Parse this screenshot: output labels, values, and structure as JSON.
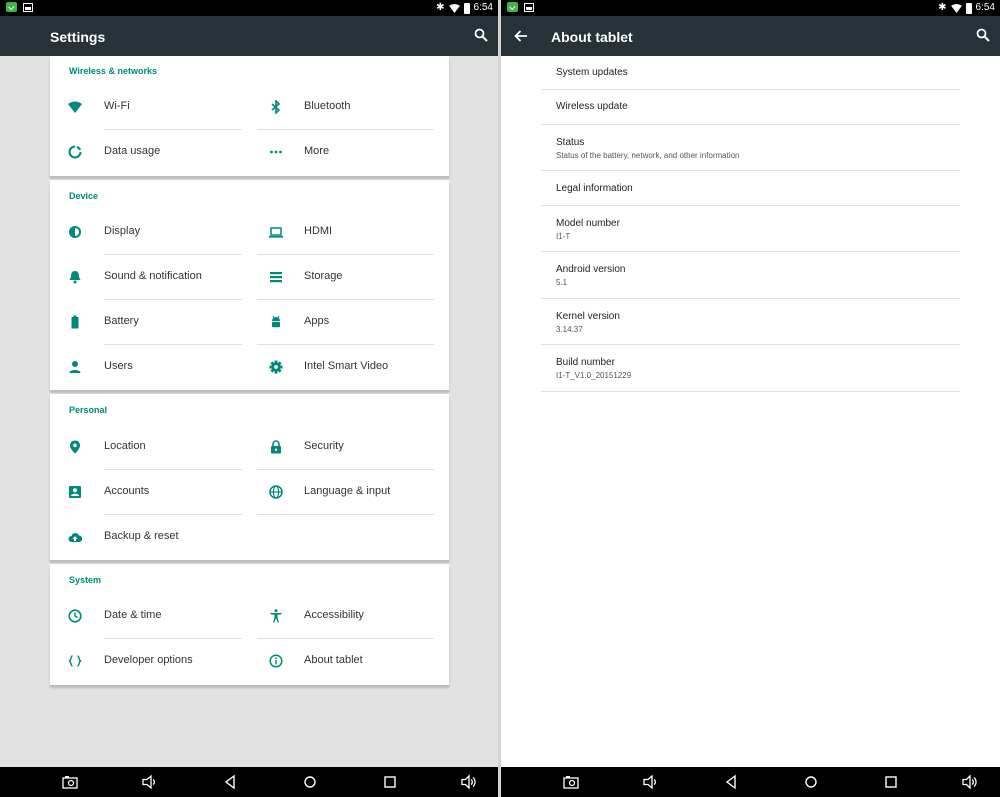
{
  "status_bar": {
    "time": "6:54",
    "icons": [
      "notification-icon",
      "image-icon",
      "bluetooth-icon",
      "wifi-icon",
      "battery-icon"
    ]
  },
  "settings": {
    "title": "Settings",
    "sections": [
      {
        "label": "Wireless & networks",
        "items": [
          "Wi-Fi",
          "Bluetooth",
          "Data usage",
          "More"
        ]
      },
      {
        "label": "Device",
        "items": [
          "Display",
          "HDMI",
          "Sound & notification",
          "Storage",
          "Battery",
          "Apps",
          "Users",
          "Intel Smart Video"
        ]
      },
      {
        "label": "Personal",
        "items": [
          "Location",
          "Security",
          "Accounts",
          "Language & input",
          "Backup & reset"
        ]
      },
      {
        "label": "System",
        "items": [
          "Date & time",
          "Accessibility",
          "Developer options",
          "About tablet"
        ]
      }
    ]
  },
  "about": {
    "title": "About tablet",
    "items": [
      {
        "title": "System updates",
        "subtitle": ""
      },
      {
        "title": "Wireless update",
        "subtitle": ""
      },
      {
        "title": "Status",
        "subtitle": "Status of the battery, network, and other information"
      },
      {
        "title": "Legal information",
        "subtitle": ""
      },
      {
        "title": "Model number",
        "subtitle": "I1-T"
      },
      {
        "title": "Android version",
        "subtitle": "5.1"
      },
      {
        "title": "Kernel version",
        "subtitle": "3.14.37"
      },
      {
        "title": "Build number",
        "subtitle": "I1-T_V1.0_20151229"
      }
    ]
  },
  "nav_bar": {
    "buttons": [
      "screenshot-icon",
      "volume-down-icon",
      "back-icon",
      "home-icon",
      "recents-icon",
      "volume-up-icon"
    ]
  },
  "colors": {
    "app_bar": "#263238",
    "accent": "#00897b",
    "icon": "#00897b",
    "background": "#e2e2e2"
  }
}
